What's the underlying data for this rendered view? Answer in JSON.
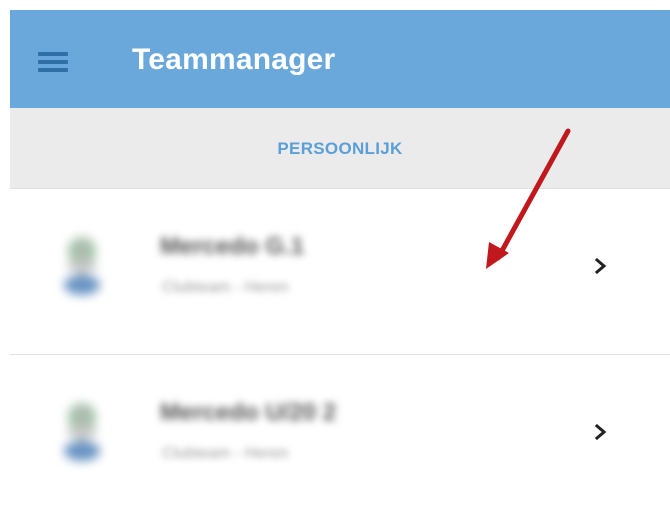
{
  "app": {
    "title": "Teammanager"
  },
  "tabs": [
    {
      "label": "PERSOONLIJK",
      "active": true
    }
  ],
  "teams": [
    {
      "name": "Mercedo G.1",
      "meta": "Clubteam - Heren",
      "blurred": true
    },
    {
      "name": "Mercedo U/20 2",
      "meta": "Clubteam - Heren",
      "blurred": true
    }
  ],
  "icons": {
    "menu": "hamburger-menu-icon",
    "row_action": "chevron-right-icon",
    "avatar": "team-logo-icon",
    "annotation": "red-arrow-annotation"
  },
  "colors": {
    "appbar": "#6aa8dc",
    "menu_icon": "#2f6fa8",
    "tab_accent": "#5a9fd8",
    "annotation_arrow": "#c0181c"
  }
}
